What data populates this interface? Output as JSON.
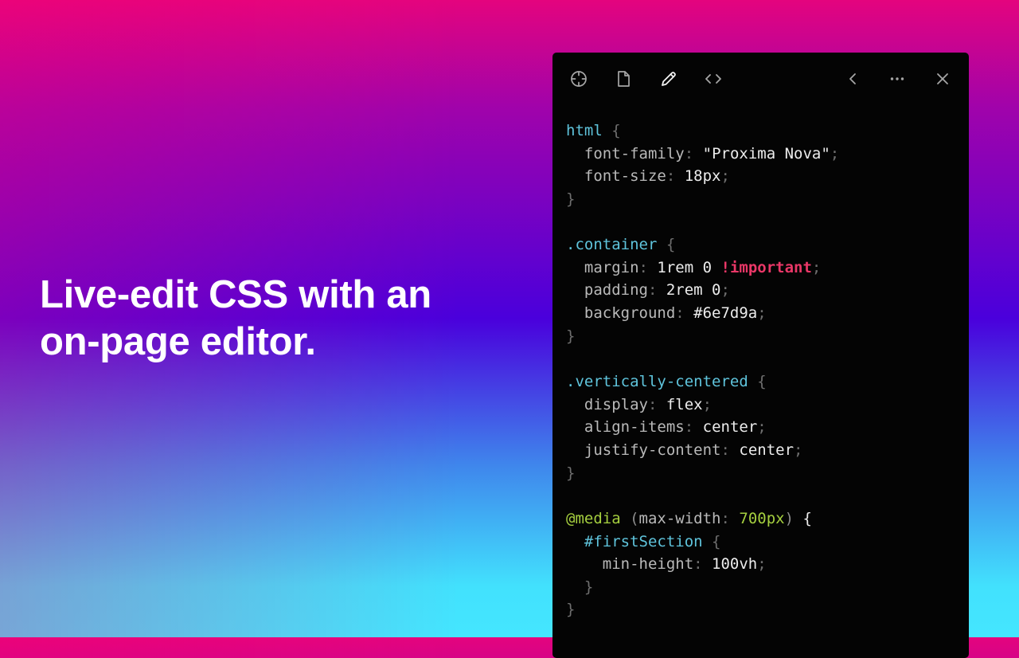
{
  "headline": {
    "line1": "Live-edit CSS with an",
    "line2": "on-page editor."
  },
  "toolbar": {
    "icons": [
      "crosshair-icon",
      "file-icon",
      "pencil-icon",
      "code-icon",
      "chevron-left-icon",
      "more-icon",
      "close-icon"
    ]
  },
  "colors": {
    "selector": "#5fc4dc",
    "at_rule": "#a5cf3f",
    "important": "#ea3767",
    "panel_bg": "#040404"
  },
  "code": {
    "rule1": {
      "selector": "html",
      "open": " {",
      "close": "}",
      "decls": [
        {
          "prop": "font-family",
          "value": "\"Proxima Nova\""
        },
        {
          "prop": "font-size",
          "value": "18px"
        }
      ]
    },
    "rule2": {
      "selector": ".container",
      "open": " {",
      "close": "}",
      "decls": [
        {
          "prop": "margin",
          "value": "1rem 0 ",
          "important": "!important"
        },
        {
          "prop": "padding",
          "value": "2rem 0"
        },
        {
          "prop": "background",
          "value": "#6e7d9a"
        }
      ]
    },
    "rule3": {
      "selector": ".vertically-centered",
      "open": " {",
      "close": "}",
      "decls": [
        {
          "prop": "display",
          "value": "flex"
        },
        {
          "prop": "align-items",
          "value": "center"
        },
        {
          "prop": "justify-content",
          "value": "center"
        }
      ]
    },
    "media": {
      "keyword": "@media",
      "feature": "max-width",
      "feature_value": "700px",
      "open": " {",
      "close": "}",
      "inner": {
        "selector": "#firstSection",
        "open": " {",
        "close": "}",
        "decl": {
          "prop": "min-height",
          "value": "100vh"
        }
      }
    },
    "sep": ": ",
    "semi": ";",
    "lparen": " (",
    "rparen": ")"
  }
}
